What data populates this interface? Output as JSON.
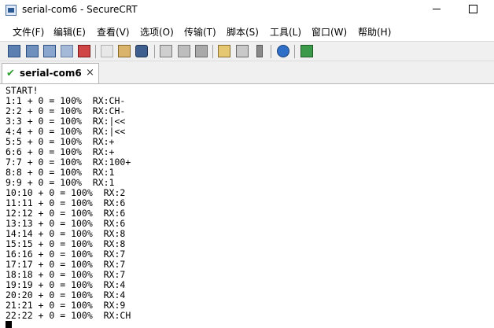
{
  "window": {
    "title": "serial-com6 - SecureCRT",
    "minimize_glyph": "",
    "maximize_glyph": ""
  },
  "menu": {
    "items": [
      {
        "label": "文件(F)"
      },
      {
        "label": "编辑(E)"
      },
      {
        "label": "查看(V)"
      },
      {
        "label": "选项(O)"
      },
      {
        "label": "传输(T)"
      },
      {
        "label": "脚本(S)"
      },
      {
        "label": "工具(L)"
      },
      {
        "label": "窗口(W)"
      },
      {
        "label": "帮助(H)"
      }
    ]
  },
  "toolbar": {
    "icons": [
      "connect-icon",
      "quick-connect-icon",
      "connect-in-tab-icon",
      "reconnect-icon",
      "disconnect-icon",
      "copy-icon",
      "paste-icon",
      "find-icon",
      "print-icon",
      "print-setup-icon",
      "printer-icon",
      "session-options-icon",
      "keymap-icon",
      "sftp-icon",
      "help-icon",
      "screen-icon"
    ]
  },
  "tab": {
    "label": "serial-com6",
    "close_glyph": "×",
    "check_glyph": "✔",
    "status_color": "#2e9e2e"
  },
  "terminal": {
    "lines": [
      "START!",
      "1:1 + 0 = 100%  RX:CH-",
      "2:2 + 0 = 100%  RX:CH-",
      "3:3 + 0 = 100%  RX:|<<",
      "4:4 + 0 = 100%  RX:|<<",
      "5:5 + 0 = 100%  RX:+",
      "6:6 + 0 = 100%  RX:+",
      "7:7 + 0 = 100%  RX:100+",
      "8:8 + 0 = 100%  RX:1",
      "9:9 + 0 = 100%  RX:1",
      "10:10 + 0 = 100%  RX:2",
      "11:11 + 0 = 100%  RX:6",
      "12:12 + 0 = 100%  RX:6",
      "13:13 + 0 = 100%  RX:6",
      "14:14 + 0 = 100%  RX:8",
      "15:15 + 0 = 100%  RX:8",
      "16:16 + 0 = 100%  RX:7",
      "17:17 + 0 = 100%  RX:7",
      "18:18 + 0 = 100%  RX:7",
      "19:19 + 0 = 100%  RX:4",
      "20:20 + 0 = 100%  RX:4",
      "21:21 + 0 = 100%  RX:9",
      "22:22 + 0 = 100%  RX:CH"
    ]
  }
}
